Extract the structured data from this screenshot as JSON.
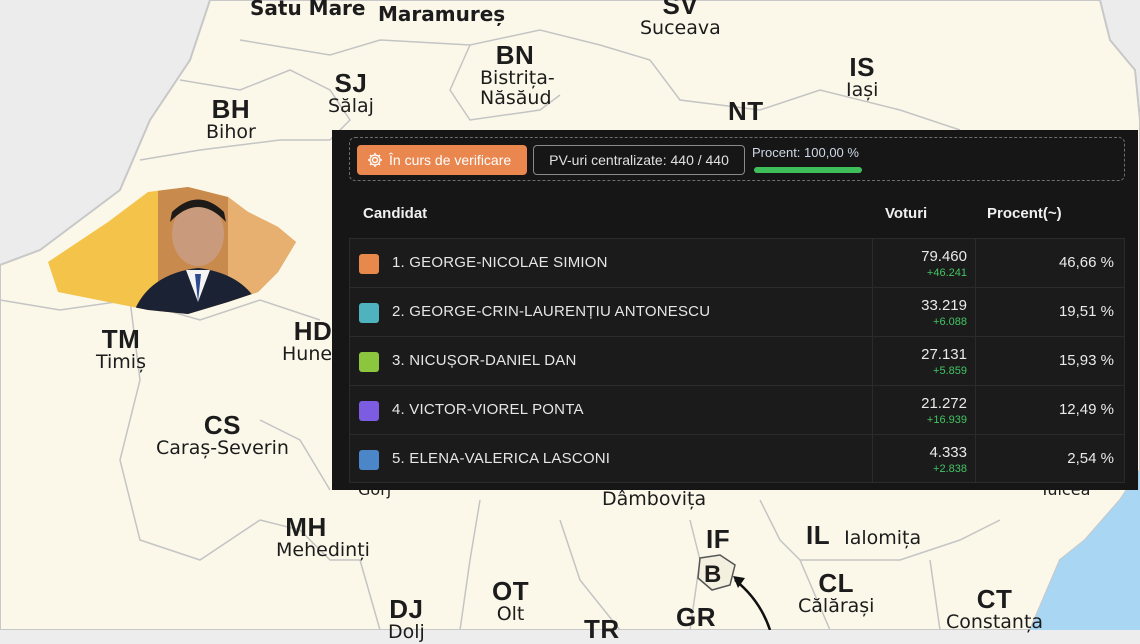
{
  "map": {
    "counties": [
      {
        "code": "",
        "name": "Satu Mare"
      },
      {
        "code": "",
        "name": "Maramureș"
      },
      {
        "code": "SV",
        "name": "Suceava"
      },
      {
        "code": "BN",
        "name": "Bistrița-Năsăud"
      },
      {
        "code": "IS",
        "name": "Iași"
      },
      {
        "code": "SJ",
        "name": "Sălaj"
      },
      {
        "code": "BH",
        "name": "Bihor"
      },
      {
        "code": "NT",
        "name": ""
      },
      {
        "code": "TM",
        "name": "Timiș"
      },
      {
        "code": "HD",
        "name": "Huned"
      },
      {
        "code": "CS",
        "name": "Caraș-Severin"
      },
      {
        "code": "",
        "name": "Gorj"
      },
      {
        "code": "MH",
        "name": "Mehedinți"
      },
      {
        "code": "",
        "name": "Dâmbovița"
      },
      {
        "code": "IF",
        "name": ""
      },
      {
        "code": "B",
        "name": ""
      },
      {
        "code": "IL",
        "name": "Ialomița"
      },
      {
        "code": "CL",
        "name": "Călărași"
      },
      {
        "code": "CT",
        "name": "Constanța"
      },
      {
        "code": "DJ",
        "name": "Dolj"
      },
      {
        "code": "OT",
        "name": "Olt"
      },
      {
        "code": "TR",
        "name": ""
      },
      {
        "code": "GR",
        "name": ""
      },
      {
        "code": "",
        "name": "Tulcea"
      }
    ]
  },
  "status": {
    "verify_label": "În curs de verificare",
    "pv_label": "PV-uri centralizate: 440 / 440",
    "percent_label": "Procent: 100,00 %",
    "percent_value": 1.0
  },
  "table": {
    "headers": {
      "candidate": "Candidat",
      "votes": "Voturi",
      "percent": "Procent(~)"
    },
    "rows": [
      {
        "name": "1. GEORGE-NICOLAE SIMION",
        "votes": "79.460",
        "delta": "+46.241",
        "percent": "46,66 %",
        "color": "#e6894a"
      },
      {
        "name": "2. GEORGE-CRIN-LAURENȚIU ANTONESCU",
        "votes": "33.219",
        "delta": "+6.088",
        "percent": "19,51 %",
        "color": "#4fb3bf"
      },
      {
        "name": "3. NICUȘOR-DANIEL DAN",
        "votes": "27.131",
        "delta": "+5.859",
        "percent": "15,93 %",
        "color": "#8cc63f"
      },
      {
        "name": "4. VICTOR-VIOREL PONTA",
        "votes": "21.272",
        "delta": "+16.939",
        "percent": "12,49 %",
        "color": "#7c5ce0"
      },
      {
        "name": "5. ELENA-VALERICA LASCONI",
        "votes": "4.333",
        "delta": "+2.838",
        "percent": "2,54 %",
        "color": "#4a86c8"
      }
    ]
  },
  "colors": {
    "panel_bg": "#161616",
    "accent_orange": "#e9874f",
    "progress_green": "#3fbf5a",
    "map_fill": "#fbf8ea",
    "map_border": "#bdbdbd",
    "sea": "#a9d6f2",
    "highlight_region": "#f4c34a"
  }
}
